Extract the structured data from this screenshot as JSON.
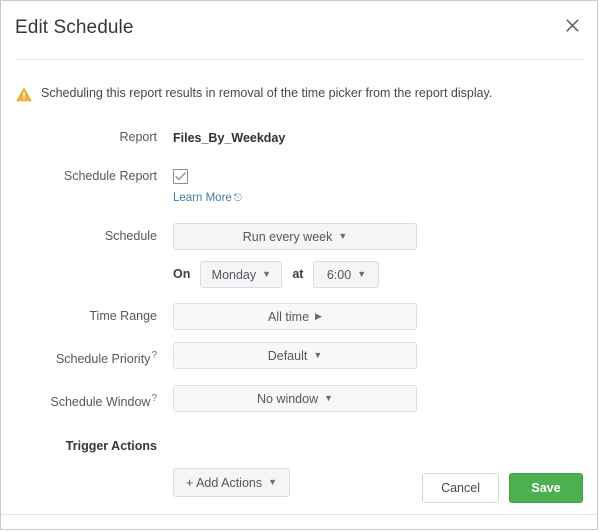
{
  "dialog": {
    "title": "Edit Schedule",
    "close_icon": "close-icon"
  },
  "warning": {
    "icon": "warning-triangle-icon",
    "text": "Scheduling this report results in removal of the time picker from the report display.",
    "color": "#f0b03a"
  },
  "form": {
    "report": {
      "label": "Report",
      "value": "Files_By_Weekday"
    },
    "schedule_report": {
      "label": "Schedule Report",
      "checked": true,
      "check_icon": "checkmark-icon",
      "learn_more_label": "Learn More",
      "learn_more_icon": "external-link-icon",
      "link_color": "#3f7fa0"
    },
    "schedule": {
      "label": "Schedule",
      "frequency_value": "Run every week",
      "on_label": "On",
      "day_value": "Monday",
      "at_label": "at",
      "time_value": "6:00"
    },
    "time_range": {
      "label": "Time Range",
      "value": "All time",
      "arrow": "caret-right-icon"
    },
    "schedule_priority": {
      "label": "Schedule Priority",
      "help_icon": "question-mark-icon",
      "value": "Default"
    },
    "schedule_window": {
      "label": "Schedule Window",
      "help_icon": "question-mark-icon",
      "value": "No window"
    },
    "trigger_actions": {
      "label": "Trigger Actions",
      "add_actions_label": "+ Add Actions"
    }
  },
  "footer": {
    "cancel_label": "Cancel",
    "save_label": "Save",
    "save_color": "#4caf50"
  }
}
